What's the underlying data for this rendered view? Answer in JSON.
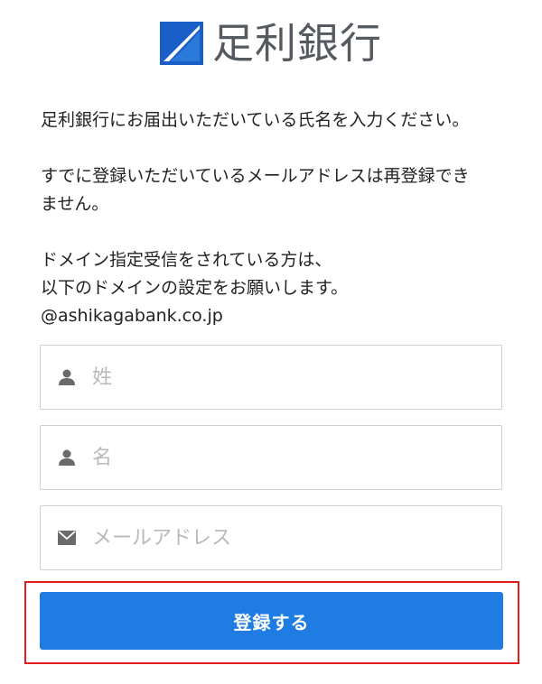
{
  "header": {
    "logo_icon": "bank-logo-icon",
    "bank_name": "足利銀行"
  },
  "intro": {
    "name_prompt": "足利銀行にお届出いただいている氏名を入力ください。",
    "email_notice_line1": "すでに登録いただいているメールアドレスは再登録でき",
    "email_notice_line2": "ません。",
    "domain_notice_line1": "ドメイン指定受信をされている方は、",
    "domain_notice_line2": "以下のドメインの設定をお願いします。",
    "domain": "@ashikagabank.co.jp"
  },
  "form": {
    "last_name": {
      "icon": "person-icon",
      "placeholder": "姓",
      "value": ""
    },
    "first_name": {
      "icon": "person-icon",
      "placeholder": "名",
      "value": ""
    },
    "email": {
      "icon": "envelope-icon",
      "placeholder": "メールアドレス",
      "value": ""
    },
    "submit_label": "登録する"
  },
  "colors": {
    "logo_blue": "#1a5fc8",
    "logo_text": "#555a60",
    "button_blue": "#1f7ce3",
    "highlight_red": "#e01b1b",
    "icon_gray": "#6a6a6a",
    "placeholder_gray": "#b9b9b9"
  }
}
